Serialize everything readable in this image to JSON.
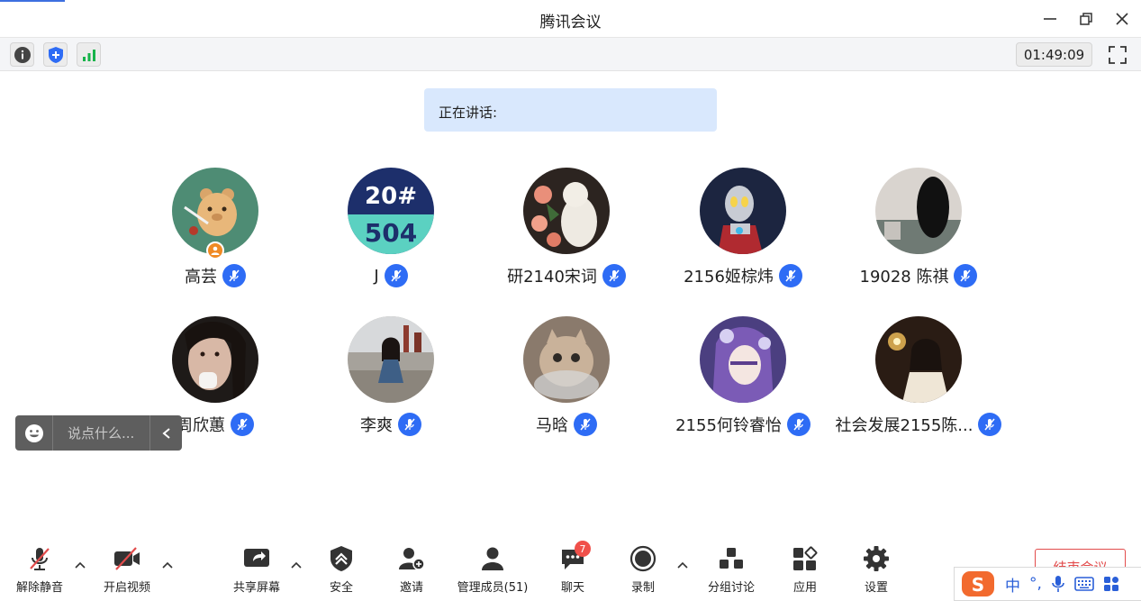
{
  "window": {
    "title": "腾讯会议"
  },
  "infobar": {
    "timer": "01:49:09"
  },
  "speaking": {
    "label": "正在讲话:"
  },
  "participants": [
    {
      "name": "高芸",
      "host": true
    },
    {
      "name": "J",
      "host": false
    },
    {
      "name": "研2140宋词",
      "host": false
    },
    {
      "name": "2156姬棕炜",
      "host": false
    },
    {
      "name": "19028 陈祺",
      "host": false
    },
    {
      "name": "周欣蕙",
      "host": false
    },
    {
      "name": "李爽",
      "host": false
    },
    {
      "name": "马晗",
      "host": false
    },
    {
      "name": "2155何铃睿怡",
      "host": false
    },
    {
      "name": "社会发展2155陈...",
      "host": false
    }
  ],
  "avatar_texts": {
    "line1": "20#",
    "line2": "504"
  },
  "chat": {
    "placeholder": "说点什么..."
  },
  "toolbar": {
    "unmute": "解除静音",
    "start_video": "开启视频",
    "share_screen": "共享屏幕",
    "security": "安全",
    "invite": "邀请",
    "manage_members": "管理成员(51)",
    "chat": "聊天",
    "chat_badge": "7",
    "record": "录制",
    "breakout": "分组讨论",
    "apps": "应用",
    "settings": "设置",
    "end_meeting": "结束会议"
  },
  "ime": {
    "lang": "中",
    "punct": "°,"
  },
  "colors": {
    "accent": "#2e6cf5",
    "end": "#e24c4c",
    "host_badge": "#f08a24",
    "speaking_bg": "#d9e8fd"
  }
}
